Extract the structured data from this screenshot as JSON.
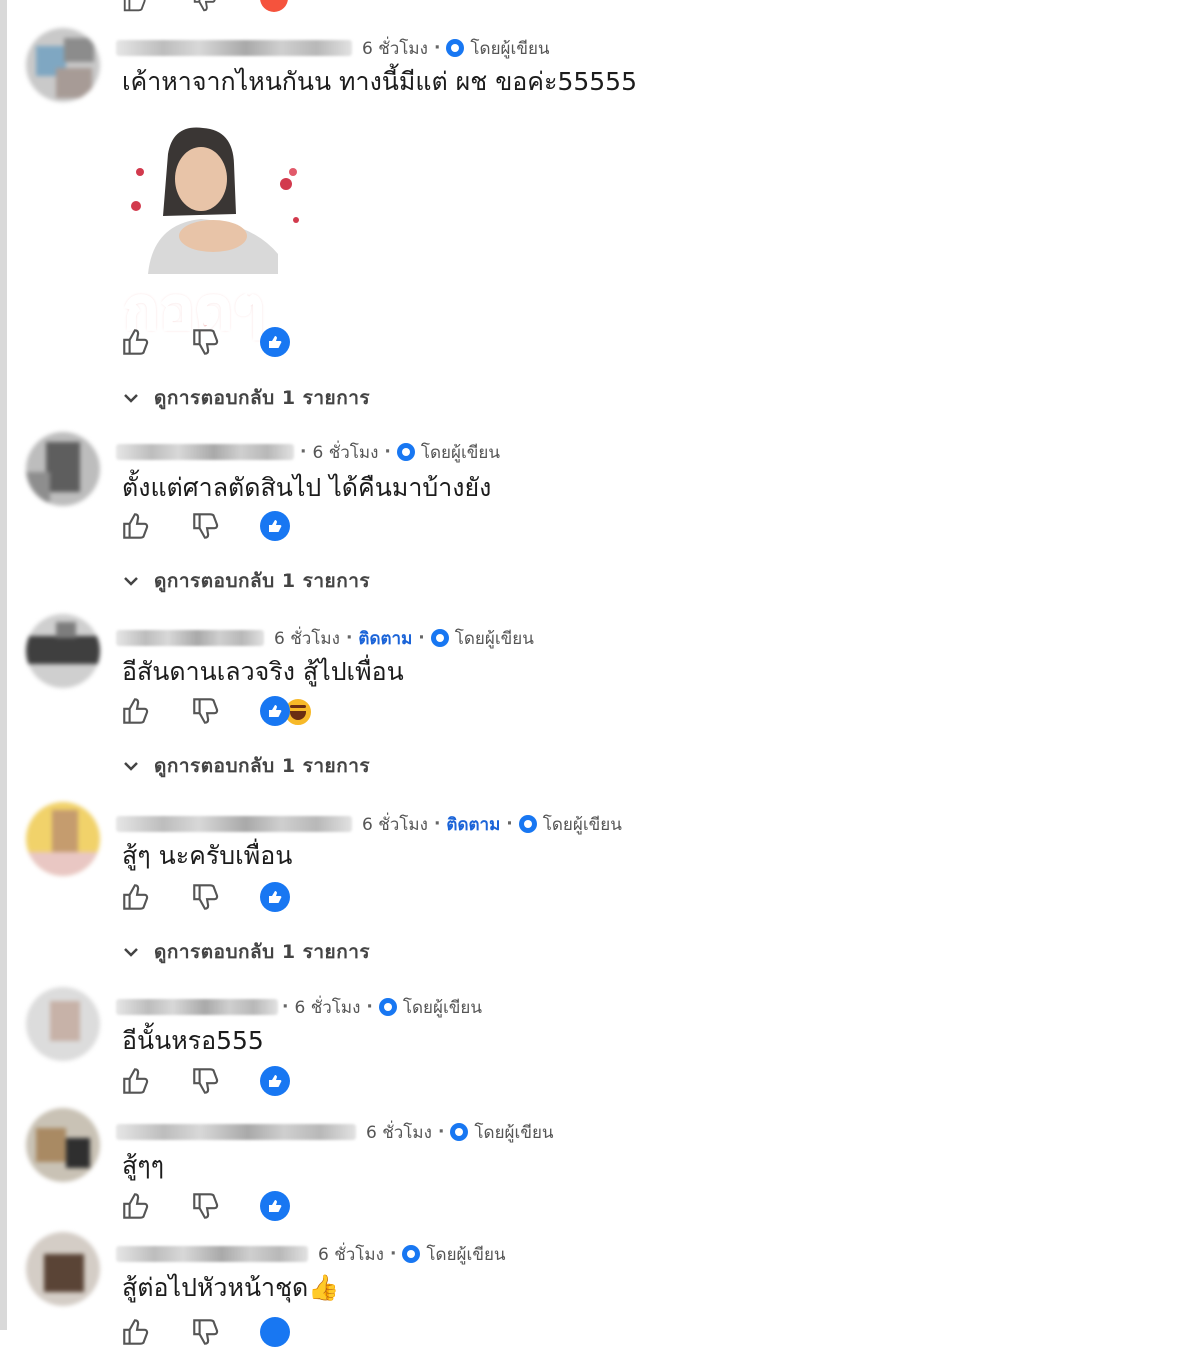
{
  "colors": {
    "accent": "#1877f2",
    "follow": "#1b64d8",
    "text": "#1c1c1c",
    "meta": "#555555"
  },
  "common": {
    "time": "6 ชั่วโมง",
    "author_badge": "โดยผู้เขียน",
    "follow": "ติดตาม",
    "separator": "·",
    "view_replies": "ดูการตอบกลับ 1 รายการ",
    "icons": {
      "like": "thumbs-up-icon",
      "dislike": "thumbs-down-icon",
      "reaction": "like-reaction-icon",
      "expand": "chevron-down-icon",
      "badge": "author-badge-icon"
    }
  },
  "comments": [
    {
      "text": "เค้าหาจากไหนกันน ทางนี้มีแต่ ผช ขอค่ะ55555",
      "follow": false,
      "has_sticker": true,
      "sticker_text": "กอดๆ",
      "reactions": [
        "like"
      ],
      "replies": true
    },
    {
      "text": "ตั้งแต่ศาลตัดสินไป ได้คืนมาบ้างยัง",
      "follow": false,
      "reactions": [
        "like"
      ],
      "replies": true
    },
    {
      "text": "อีสันดานเลวจริง สู้ไปเพื่อน",
      "follow": true,
      "reactions": [
        "like",
        "haha"
      ],
      "replies": true
    },
    {
      "text": "สู้ๆ นะครับเพื่อน",
      "follow": true,
      "reactions": [
        "like"
      ],
      "replies": true
    },
    {
      "text": "อีนั้นหรอ555",
      "follow": false,
      "reactions": [
        "like"
      ],
      "replies": false
    },
    {
      "text": "สู้ๆๆ",
      "follow": false,
      "reactions": [
        "like"
      ],
      "replies": false
    },
    {
      "text": "สู้ต่อไปหัวหน้าชุด👍",
      "follow": false,
      "reactions": [
        "like"
      ],
      "replies": false
    }
  ]
}
